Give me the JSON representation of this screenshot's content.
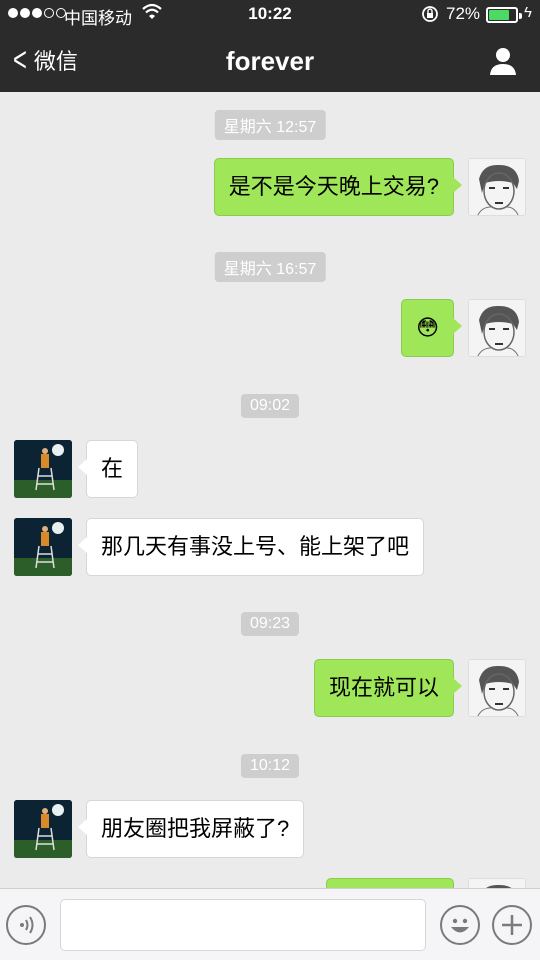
{
  "status_bar": {
    "carrier": "中国移动",
    "time": "10:22",
    "battery_pct": "72%",
    "battery_level": 0.72
  },
  "nav": {
    "back_label": "微信",
    "title": "forever"
  },
  "messages": {
    "ts1": "星期六 12:57",
    "m1": "是不是今天晚上交易?",
    "ts2": "星期六 16:57",
    "m2": "😳",
    "ts3": "09:02",
    "m3": "在",
    "m4": "那几天有事没上号、能上架了吧",
    "ts4": "09:23",
    "m5": "现在就可以",
    "ts5": "10:12",
    "m6": "朋友圈把我屏蔽了?"
  },
  "icons": [
    "wifi-icon",
    "lock-rotation-icon",
    "battery-icon",
    "charging-icon",
    "back-chevron-icon",
    "profile-icon",
    "voice-icon",
    "emoji-icon",
    "plus-icon"
  ],
  "colors": {
    "nav_bg": "#2b2b2b",
    "chat_bg": "#ebebeb",
    "outgoing_bubble": "#9fe658",
    "incoming_bubble": "#ffffff",
    "battery_fill": "#4cd964"
  }
}
